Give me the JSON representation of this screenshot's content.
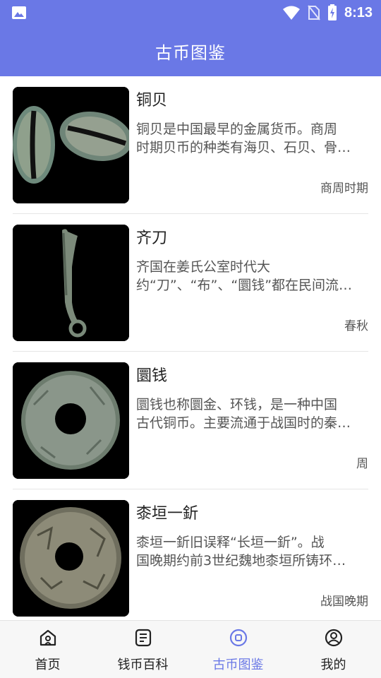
{
  "status_bar": {
    "time": "8:13"
  },
  "app_bar": {
    "title": "古币图鉴"
  },
  "items": [
    {
      "name": "铜贝",
      "desc_line1": "铜贝是中国最早的金属货币。商周",
      "desc_line2": "时期贝币的种类有海贝、石贝、骨…",
      "era": "商周时期"
    },
    {
      "name": "齐刀",
      "desc_line1": "齐国在姜氏公室时代大",
      "desc_line2": "约“刀”、“布”、“圜钱”都在民间流…",
      "era": "春秋"
    },
    {
      "name": "圜钱",
      "desc_line1": "圜钱也称圜金、环钱，是一种中国",
      "desc_line2": "古代铜币。主要流通于战国时的秦…",
      "era": "周"
    },
    {
      "name": "桼垣一釿",
      "desc_line1": "桼垣一釿旧误释“长垣一釿”。战",
      "desc_line2": "国晚期约前3世纪魏地桼垣所铸环…",
      "era": "战国晚期"
    }
  ],
  "tabs": [
    {
      "label": "首页",
      "icon": "home-icon"
    },
    {
      "label": "钱币百科",
      "icon": "encyclopedia-icon"
    },
    {
      "label": "古币图鉴",
      "icon": "coin-icon"
    },
    {
      "label": "我的",
      "icon": "profile-icon"
    }
  ],
  "colors": {
    "primary": "#6a78e6",
    "text": "#222222",
    "subtext": "#555555"
  }
}
